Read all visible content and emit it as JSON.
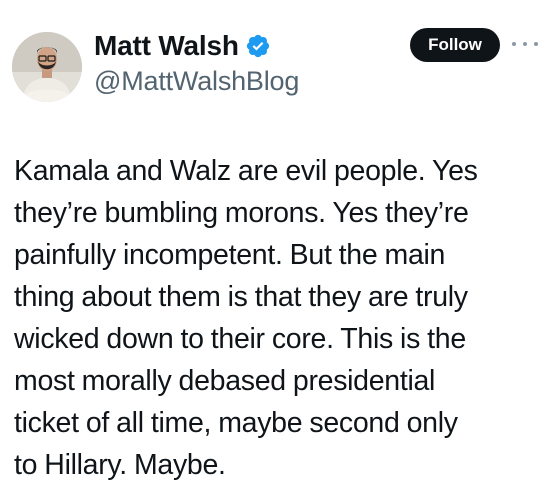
{
  "author": {
    "display_name": "Matt Walsh",
    "handle": "@MattWalshBlog",
    "verified": true,
    "verified_icon": "verified-badge-icon",
    "verified_color": "#1d9bf0"
  },
  "actions": {
    "follow_label": "Follow",
    "more_icon": "more-options-icon"
  },
  "tweet": {
    "lines": [
      "Kamala and Walz are evil people. Yes",
      "they’re bumbling morons. Yes they’re",
      "painfully incompetent. But the main",
      "thing about them is that they are truly",
      "wicked down to their core. This is the",
      "most morally debased presidential",
      "ticket of all time, maybe second only",
      "to Hillary. Maybe."
    ]
  },
  "colors": {
    "text": "#0f1419",
    "secondary": "#536471",
    "button_bg": "#0f1419",
    "button_text": "#ffffff"
  }
}
